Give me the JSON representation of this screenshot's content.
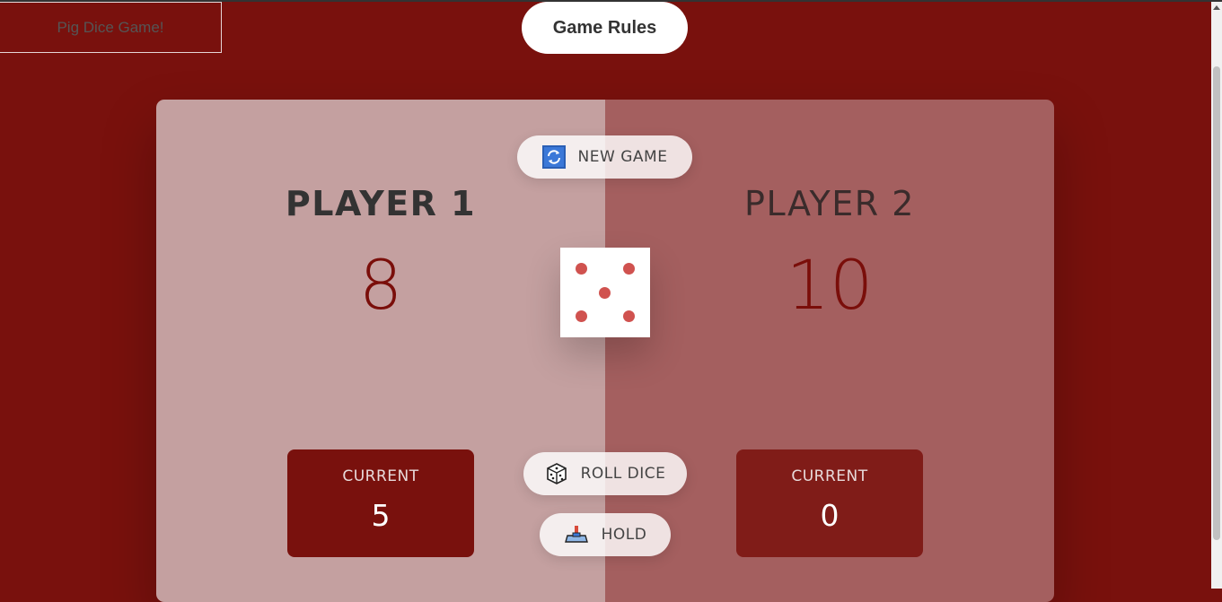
{
  "page": {
    "title_box": "Pig Dice Game!",
    "rules_button": "Game Rules"
  },
  "players": [
    {
      "name": "PLAYER 1",
      "score": "8",
      "current_label": "CURRENT",
      "current_score": "5",
      "active": true
    },
    {
      "name": "PLAYER 2",
      "score": "10",
      "current_label": "CURRENT",
      "current_score": "0",
      "active": false
    }
  ],
  "controls": {
    "new_game": {
      "label": "NEW GAME",
      "icon": "refresh-icon"
    },
    "roll_dice": {
      "label": "ROLL DICE",
      "icon": "dice-icon"
    },
    "hold": {
      "label": "HOLD",
      "icon": "hold-icon"
    }
  },
  "dice": {
    "value": 5
  },
  "colors": {
    "background": "#79110d",
    "active_panel": "#c4a0a0",
    "inactive_panel": "#a45f5f",
    "score": "#7a0e0a",
    "dice_dot": "#d0524f"
  }
}
